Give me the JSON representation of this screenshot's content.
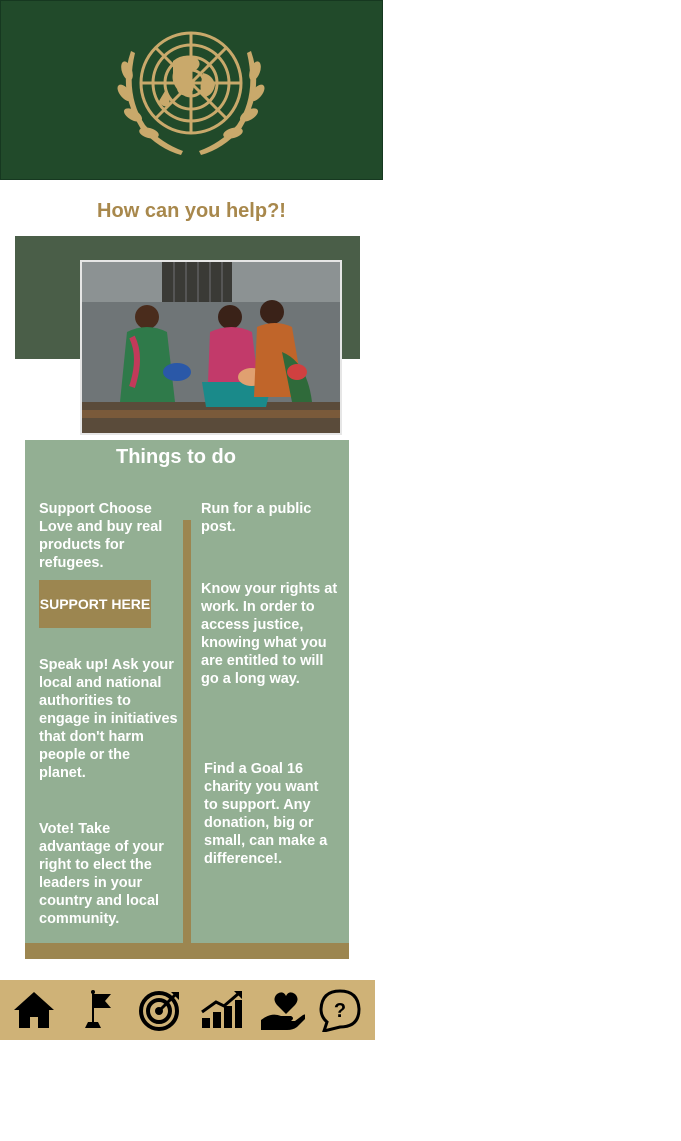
{
  "header": {
    "emblem_icon": "un-emblem-icon",
    "banner_color": "#214a2a",
    "emblem_color": "#c9a96b"
  },
  "help": {
    "title": "How can you help?!"
  },
  "photo": {
    "description_icon": "mothers-with-babies-photo"
  },
  "todo": {
    "title": "Things to do",
    "left": {
      "item1": "Support Choose Love and buy real products for refugees.",
      "button_label": "SUPPORT HERE",
      "item2": "Speak up! Ask your local and national authorities to engage in initiatives that don't harm people or the planet.",
      "item3": "Vote! Take advantage of your right to elect the leaders in your country and local community."
    },
    "right": {
      "item1": "Run for a public post.",
      "item2": "Know your rights at work. In order to access justice, knowing what you are entitled to will go a long way.",
      "item3": "Find a Goal 16 charity you want to support. Any donation, big or small, can make a difference!."
    },
    "colors": {
      "panel": "#93af93",
      "accent": "#9c8650"
    }
  },
  "nav": {
    "items": [
      {
        "icon": "home-icon"
      },
      {
        "icon": "flag-icon"
      },
      {
        "icon": "target-icon"
      },
      {
        "icon": "growth-chart-icon"
      },
      {
        "icon": "heart-hand-icon"
      },
      {
        "icon": "question-bubble-icon"
      }
    ],
    "background": "#cfb277"
  }
}
